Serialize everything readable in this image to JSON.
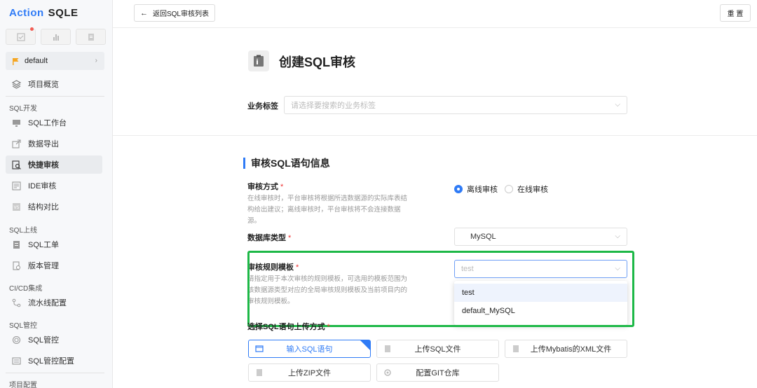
{
  "logo": {
    "part1": "Action",
    "part2": "SQLE"
  },
  "project": {
    "name": "default"
  },
  "sidebar": {
    "overview": "项目概览",
    "sections": {
      "dev": "SQL开发",
      "online": "SQL上线",
      "cicd": "CI/CD集成",
      "manage": "SQL管控",
      "config": "项目配置"
    },
    "items": {
      "workbench": "SQL工作台",
      "export": "数据导出",
      "quick_audit": "快捷审核",
      "ide_audit": "IDE审核",
      "structure": "结构对比",
      "ticket": "SQL工单",
      "version": "版本管理",
      "pipeline": "流水线配置",
      "sql_manage": "SQL管控",
      "sql_manage_config": "SQL管控配置"
    }
  },
  "topbar": {
    "back_label": "返回SQL审核列表",
    "reset_label": "重 置"
  },
  "page": {
    "title": "创建SQL审核"
  },
  "business_tag": {
    "label": "业务标签",
    "placeholder": "请选择要搜索的业务标签"
  },
  "section": {
    "title": "审核SQL语句信息"
  },
  "audit_mode": {
    "label": "审核方式",
    "help": "在线审核时，平台审核将根据所选数据源的实际库表结构给出建议；离线审核时，平台审核将不会连接数据源。",
    "options": [
      "离线审核",
      "在线审核"
    ],
    "selected": "离线审核"
  },
  "db_type": {
    "label": "数据库类型",
    "value": "MySQL"
  },
  "rule_template": {
    "label": "审核规则模板",
    "help": "请指定用于本次审核的规则模板，可选用的模板范围为该数据源类型对应的全局审核规则模板及当前项目内的审核规则模板。",
    "placeholder": "test",
    "options": [
      "test",
      "default_MySQL"
    ]
  },
  "upload": {
    "label": "选择SQL语句上传方式",
    "options": [
      "输入SQL语句",
      "上传SQL文件",
      "上传Mybatis的XML文件",
      "上传ZIP文件",
      "配置GIT仓库"
    ]
  },
  "colors": {
    "accent": "#2f7bf6",
    "highlight": "#1db847"
  }
}
